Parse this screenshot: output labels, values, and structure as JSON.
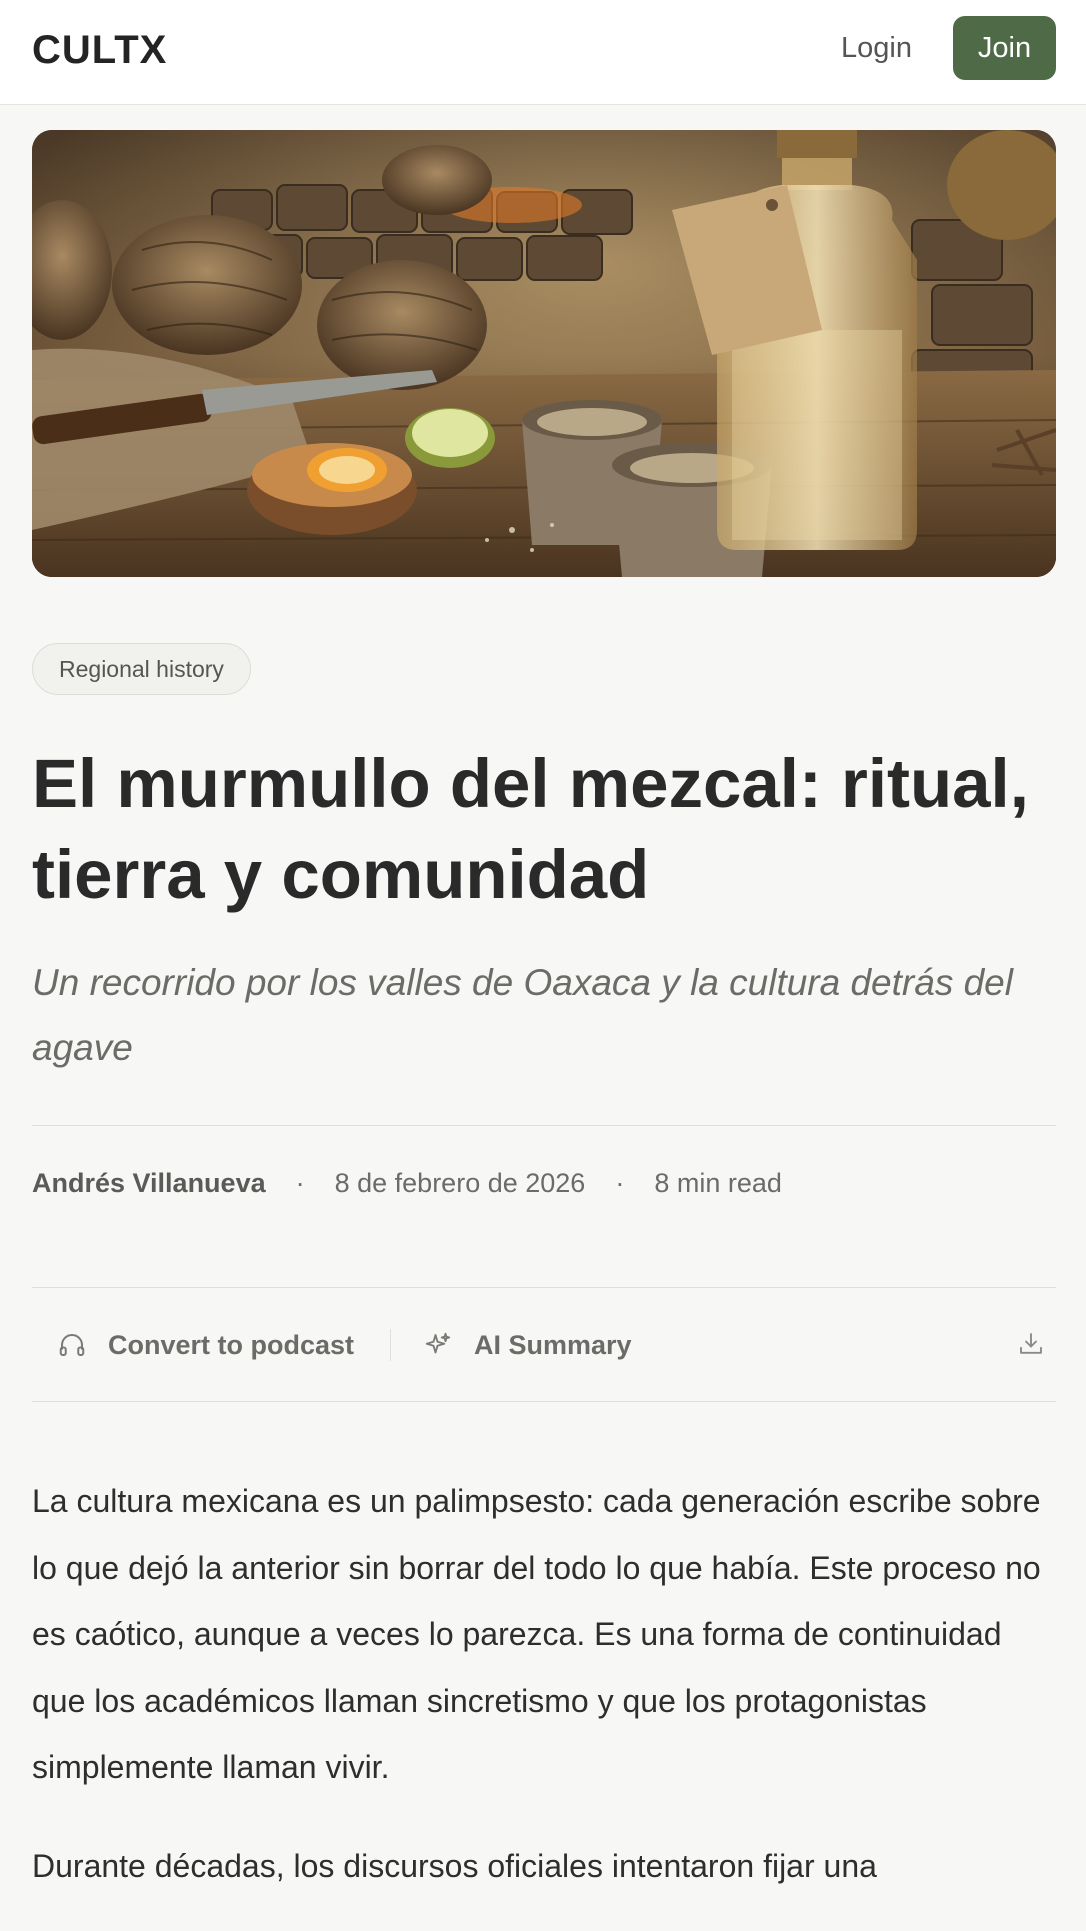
{
  "header": {
    "logo": "CULTX",
    "login_label": "Login",
    "join_label": "Join"
  },
  "hero": {
    "alt": "Mezcal bottle, clay cups, orange slices and roasted agave piñas on a rustic wooden table"
  },
  "article": {
    "tag": "Regional history",
    "title": "El murmullo del mezcal: ritual, tierra y comunidad",
    "subtitle": "Un recorrido por los valles de Oaxaca y la cultura detrás del agave",
    "author": "Andrés Villanueva",
    "separator": "·",
    "date": "8 de febrero de 2026",
    "read_time": "8 min read",
    "paragraphs": [
      "La cultura mexicana es un palimpsesto: cada generación escribe sobre lo que dejó la anterior sin borrar del todo lo que había. Este proceso no es caótico, aunque a veces lo parezca. Es una forma de continuidad que los académicos llaman sincretismo y que los protagonistas simplemente llaman vivir.",
      "Durante décadas, los discursos oficiales intentaron fijar una"
    ]
  },
  "actions": {
    "podcast_label": "Convert to podcast",
    "podcast_icon": "headphones-icon",
    "summary_label": "AI Summary",
    "summary_icon": "sparkle-icon",
    "download_icon": "download-icon"
  },
  "colors": {
    "accent": "#4e6a46",
    "background": "#f7f7f5",
    "header_bg": "#ffffff"
  }
}
